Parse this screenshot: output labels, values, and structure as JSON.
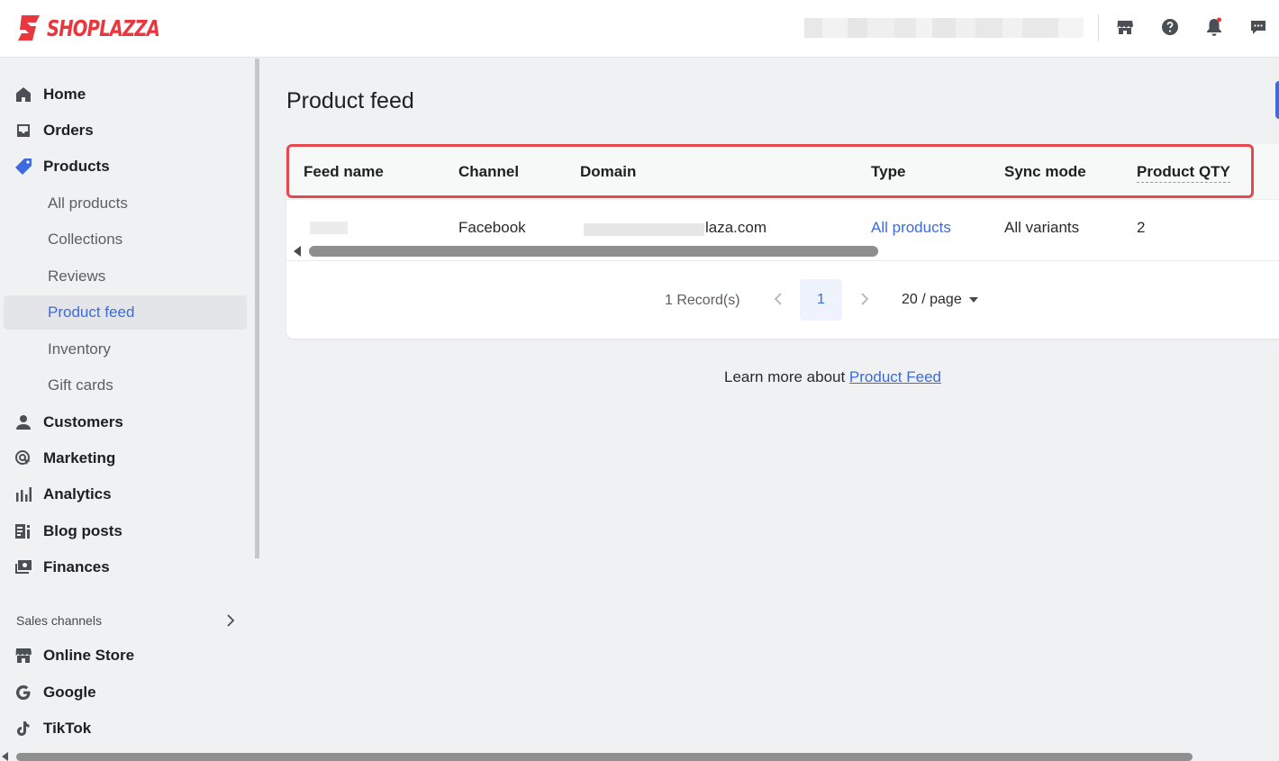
{
  "brand": {
    "name": "SHOPLAZZA",
    "color": "#e8383d"
  },
  "topbar": {
    "icons": [
      "store-icon",
      "help-icon",
      "notification-bell-icon",
      "message-icon"
    ]
  },
  "sidebar": {
    "items": [
      {
        "label": "Home",
        "icon": "home-icon"
      },
      {
        "label": "Orders",
        "icon": "orders-icon"
      },
      {
        "label": "Products",
        "icon": "tag-icon"
      },
      {
        "label": "All products"
      },
      {
        "label": "Collections"
      },
      {
        "label": "Reviews"
      },
      {
        "label": "Product feed",
        "active": true
      },
      {
        "label": "Inventory"
      },
      {
        "label": "Gift cards"
      },
      {
        "label": "Customers",
        "icon": "person-icon"
      },
      {
        "label": "Marketing",
        "icon": "marketing-icon"
      },
      {
        "label": "Analytics",
        "icon": "bar-chart-icon"
      },
      {
        "label": "Blog posts",
        "icon": "blog-icon"
      },
      {
        "label": "Finances",
        "icon": "finances-icon"
      }
    ],
    "sales_channels_label": "Sales channels",
    "channels": [
      {
        "label": "Online Store",
        "icon": "store-icon"
      },
      {
        "label": "Google",
        "icon": "google-icon"
      },
      {
        "label": "TikTok",
        "icon": "tiktok-icon"
      }
    ]
  },
  "main": {
    "title": "Product feed",
    "table": {
      "headers": [
        "Feed name",
        "Channel",
        "Domain",
        "Type",
        "Sync mode",
        "Product QTY"
      ],
      "rows": [
        {
          "channel": "Facebook",
          "domain_suffix": "laza.com",
          "type": "All products",
          "sync_mode": "All variants",
          "qty": "2"
        }
      ]
    },
    "pagination": {
      "records": "1 Record(s)",
      "current_page": "1",
      "page_size": "20 / page"
    },
    "learn_more": {
      "prefix": "Learn more about ",
      "link": "Product Feed"
    }
  },
  "colors": {
    "accent": "#3b6bdc",
    "highlight_border": "#e6484e"
  }
}
